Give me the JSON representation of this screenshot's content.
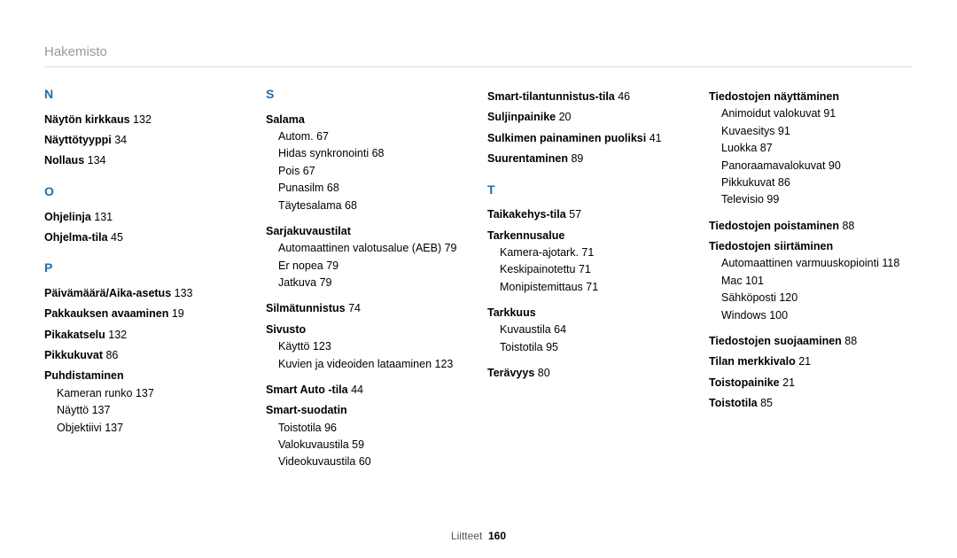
{
  "header": "Hakemisto",
  "footer_label": "Liitteet",
  "footer_page": "160",
  "columns": [
    [
      {
        "type": "letter",
        "text": "N"
      },
      {
        "type": "entry",
        "text": "Näytön kirkkaus",
        "page": "132"
      },
      {
        "type": "entry",
        "text": "Näyttötyyppi",
        "page": "34"
      },
      {
        "type": "entry",
        "text": "Nollaus",
        "page": "134"
      },
      {
        "type": "letter",
        "text": "O"
      },
      {
        "type": "entry",
        "text": "Ohjelinja",
        "page": "131"
      },
      {
        "type": "entry",
        "text": "Ohjelma-tila",
        "page": "45"
      },
      {
        "type": "letter",
        "text": "P"
      },
      {
        "type": "entry",
        "text": "Päivämäärä/Aika-asetus",
        "page": "133"
      },
      {
        "type": "entry",
        "text": "Pakkauksen avaaminen",
        "page": "19"
      },
      {
        "type": "entry",
        "text": "Pikakatselu",
        "page": "132"
      },
      {
        "type": "entry",
        "text": "Pikkukuvat",
        "page": "86"
      },
      {
        "type": "entry",
        "text": "Puhdistaminen"
      },
      {
        "type": "sub",
        "text": "Kameran runko",
        "page": "137"
      },
      {
        "type": "sub",
        "text": "Näyttö",
        "page": "137"
      },
      {
        "type": "sub",
        "text": "Objektiivi",
        "page": "137"
      }
    ],
    [
      {
        "type": "letter",
        "text": "S"
      },
      {
        "type": "entry",
        "text": "Salama"
      },
      {
        "type": "sub",
        "text": "Autom.",
        "page": "67"
      },
      {
        "type": "sub",
        "text": "Hidas synkronointi",
        "page": "68"
      },
      {
        "type": "sub",
        "text": "Pois",
        "page": "67"
      },
      {
        "type": "sub",
        "text": "Punasilm",
        "page": "68"
      },
      {
        "type": "sub",
        "text": "Täytesalama",
        "page": "68"
      },
      {
        "type": "gap"
      },
      {
        "type": "entry",
        "text": "Sarjakuvaustilat"
      },
      {
        "type": "sub",
        "text": "Automaattinen valotusalue (AEB)",
        "page": "79"
      },
      {
        "type": "sub",
        "text": "Er nopea",
        "page": "79"
      },
      {
        "type": "sub",
        "text": "Jatkuva",
        "page": "79"
      },
      {
        "type": "gap"
      },
      {
        "type": "entry",
        "text": "Silmätunnistus",
        "page": "74"
      },
      {
        "type": "entry",
        "text": "Sivusto"
      },
      {
        "type": "sub",
        "text": "Käyttö",
        "page": "123"
      },
      {
        "type": "sub",
        "text": "Kuvien ja videoiden lataaminen",
        "page": "123"
      },
      {
        "type": "gap"
      },
      {
        "type": "entry",
        "text": "Smart Auto -tila",
        "page": "44"
      },
      {
        "type": "entry",
        "text": "Smart-suodatin"
      },
      {
        "type": "sub",
        "text": "Toistotila",
        "page": "96"
      },
      {
        "type": "sub",
        "text": "Valokuvaustila",
        "page": "59"
      },
      {
        "type": "sub",
        "text": "Videokuvaustila",
        "page": "60"
      }
    ],
    [
      {
        "type": "entry",
        "text": "Smart-tilantunnistus-tila",
        "page": "46"
      },
      {
        "type": "entry",
        "text": "Suljinpainike",
        "page": "20"
      },
      {
        "type": "entry",
        "text": "Sulkimen painaminen puoliksi",
        "page": "41"
      },
      {
        "type": "entry",
        "text": "Suurentaminen",
        "page": "89"
      },
      {
        "type": "letter",
        "text": "T"
      },
      {
        "type": "entry",
        "text": "Taikakehys-tila",
        "page": "57"
      },
      {
        "type": "entry",
        "text": "Tarkennusalue"
      },
      {
        "type": "sub",
        "text": "Kamera-ajotark.",
        "page": "71"
      },
      {
        "type": "sub",
        "text": "Keskipainotettu",
        "page": "71"
      },
      {
        "type": "sub",
        "text": "Monipistemittaus",
        "page": "71"
      },
      {
        "type": "gap"
      },
      {
        "type": "entry",
        "text": "Tarkkuus"
      },
      {
        "type": "sub",
        "text": "Kuvaustila",
        "page": "64"
      },
      {
        "type": "sub",
        "text": "Toistotila",
        "page": "95"
      },
      {
        "type": "gap"
      },
      {
        "type": "entry",
        "text": "Terävyys",
        "page": "80"
      }
    ],
    [
      {
        "type": "entry",
        "text": "Tiedostojen näyttäminen"
      },
      {
        "type": "sub",
        "text": "Animoidut valokuvat",
        "page": "91"
      },
      {
        "type": "sub",
        "text": "Kuvaesitys",
        "page": "91"
      },
      {
        "type": "sub",
        "text": "Luokka",
        "page": "87"
      },
      {
        "type": "sub",
        "text": "Panoraamavalokuvat",
        "page": "90"
      },
      {
        "type": "sub",
        "text": "Pikkukuvat",
        "page": "86"
      },
      {
        "type": "sub",
        "text": "Televisio",
        "page": "99"
      },
      {
        "type": "gap"
      },
      {
        "type": "entry",
        "text": "Tiedostojen poistaminen",
        "page": "88"
      },
      {
        "type": "entry",
        "text": "Tiedostojen siirtäminen"
      },
      {
        "type": "sub",
        "text": "Automaattinen varmuuskopiointi",
        "page": "118"
      },
      {
        "type": "sub",
        "text": "Mac",
        "page": "101"
      },
      {
        "type": "sub",
        "text": "Sähköposti",
        "page": "120"
      },
      {
        "type": "sub",
        "text": "Windows",
        "page": "100"
      },
      {
        "type": "gap"
      },
      {
        "type": "entry",
        "text": "Tiedostojen suojaaminen",
        "page": "88"
      },
      {
        "type": "entry",
        "text": "Tilan merkkivalo",
        "page": "21"
      },
      {
        "type": "entry",
        "text": "Toistopainike",
        "page": "21"
      },
      {
        "type": "entry",
        "text": "Toistotila",
        "page": "85"
      }
    ]
  ]
}
